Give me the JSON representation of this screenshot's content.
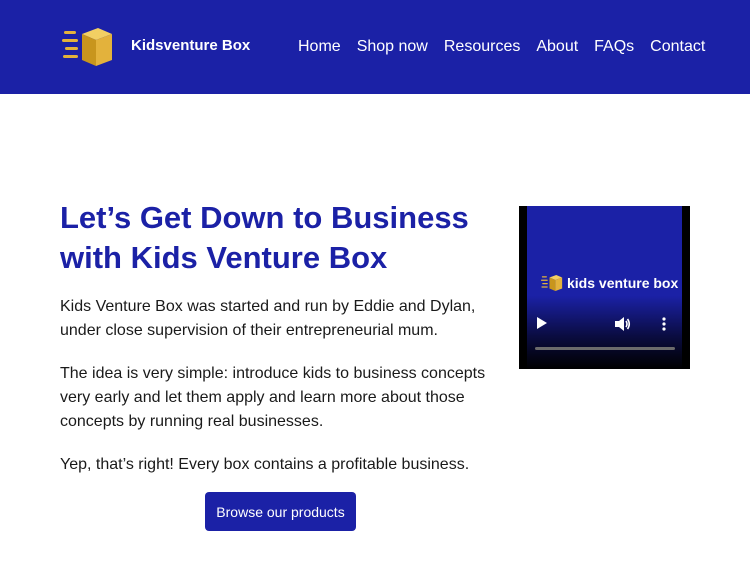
{
  "header": {
    "site_title": "Kidsventure Box",
    "logo_icon": "delivery-box-icon",
    "nav": [
      {
        "label": "Home"
      },
      {
        "label": "Shop now"
      },
      {
        "label": "Resources"
      },
      {
        "label": "About"
      },
      {
        "label": "FAQs"
      },
      {
        "label": "Contact"
      }
    ]
  },
  "main": {
    "heading": "Let’s Get Down to Business with Kids Venture Box",
    "paragraphs": [
      "Kids Venture Box was started and run by Eddie and Dylan, under close supervision of their entrepreneurial mum.",
      "The idea is very simple: introduce kids to business concepts very early and let them apply and learn more about those concepts by running real businesses.",
      "Yep, that’s right! Every box contains a profitable business."
    ],
    "cta_label": "Browse our products"
  },
  "video": {
    "logo_text": "kids venture box",
    "controls": [
      "play-icon",
      "volume-icon",
      "more-icon"
    ]
  },
  "colors": {
    "brand": "#1b21a6",
    "gold": "#d9a520",
    "text": "#1a1a1a"
  }
}
